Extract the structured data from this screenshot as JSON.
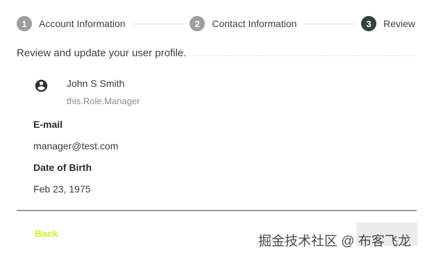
{
  "stepper": {
    "steps": [
      {
        "number": "1",
        "label": "Account Information",
        "active": false
      },
      {
        "number": "2",
        "label": "Contact Information",
        "active": false
      },
      {
        "number": "3",
        "label": "Review",
        "active": true
      }
    ]
  },
  "intro": "Review and update your user profile.",
  "profile": {
    "avatar_icon": "account-circle-icon",
    "name": "John S Smith",
    "role": "this.Role.Manager"
  },
  "fields": {
    "email_label": "E-mail",
    "email_value": "manager@test.com",
    "dob_label": "Date of Birth",
    "dob_value": "Feb 23, 1975"
  },
  "actions": {
    "back_label": "Back"
  },
  "watermark": "掘金技术社区 @ 布客飞龙",
  "colors": {
    "active_step": "#31443a",
    "inactive_step": "#9e9e9e",
    "back_button": "#d4f020"
  }
}
